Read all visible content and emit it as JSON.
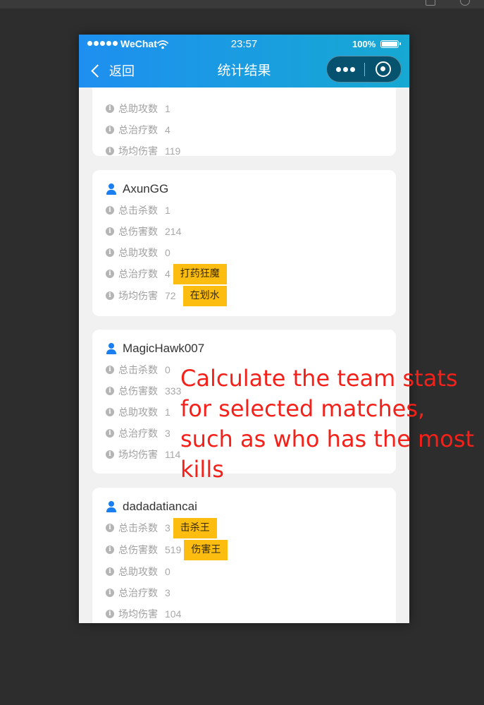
{
  "status_bar": {
    "carrier": "WeChat",
    "time": "23:57",
    "battery": "100%"
  },
  "nav": {
    "back_label": "返回",
    "title": "统计结果"
  },
  "stat_labels": {
    "kills": "总击杀数",
    "damage": "总伤害数",
    "assists": "总助攻数",
    "heals": "总治疗数",
    "avg_damage": "场均伤害"
  },
  "players": [
    {
      "name": "",
      "assists": "1",
      "heals": "4",
      "avg_damage": "119"
    },
    {
      "name": "AxunGG",
      "kills": "1",
      "damage": "214",
      "assists": "0",
      "heals": "4",
      "avg_damage": "72",
      "heals_badge": "打药狂魔",
      "avg_damage_badge": "在划水"
    },
    {
      "name": "MagicHawk007",
      "kills": "0",
      "damage": "333",
      "assists": "1",
      "heals": "3",
      "avg_damage": "114"
    },
    {
      "name": "dadadatiancai",
      "kills": "3",
      "damage": "519",
      "assists": "0",
      "heals": "3",
      "avg_damage": "104",
      "kills_badge": "击杀王",
      "damage_badge": "伤害王"
    }
  ],
  "annotation": "Calculate the team stats for selected matches, such as who has the most kills",
  "colors": {
    "header_start": "#1e8ff0",
    "header_end": "#16a9d2",
    "badge": "#fcbd10",
    "user_icon": "#1a7ef0",
    "annotation": "#f4201a",
    "page_bg": "#f1f1f1",
    "desktop_bg": "#2d2d2d"
  }
}
